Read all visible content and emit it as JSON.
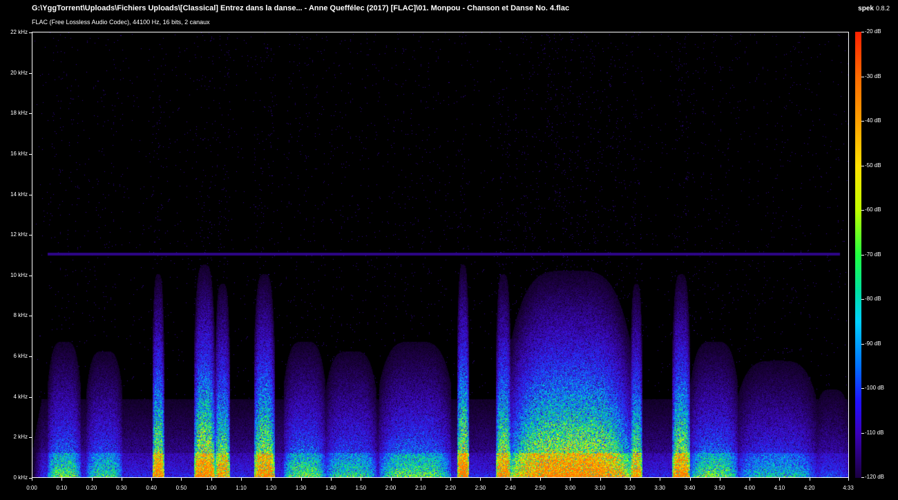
{
  "window": {
    "title": "G:\\YggTorrent\\Uploads\\Fichiers Uploads\\[Classical] Entrez dans la danse... - Anne Queffélec (2017) [FLAC]\\01. Monpou - Chanson et Danse No. 4.flac",
    "subtitle": "FLAC (Free Lossless Audio Codec), 44100 Hz, 16 bits, 2 canaux",
    "app_name": "spek",
    "app_version": "0.8.2"
  },
  "freq_axis": {
    "labels": [
      "0 kHz",
      "2 kHz",
      "4 kHz",
      "6 kHz",
      "8 kHz",
      "10 kHz",
      "12 kHz",
      "14 kHz",
      "16 kHz",
      "18 kHz",
      "20 kHz",
      "22 kHz"
    ],
    "max_khz": 22
  },
  "time_axis": {
    "labels": [
      "0:00",
      "0:10",
      "0:20",
      "0:30",
      "0:40",
      "0:50",
      "1:00",
      "1:10",
      "1:20",
      "1:30",
      "1:40",
      "1:50",
      "2:00",
      "2:10",
      "2:20",
      "2:30",
      "2:40",
      "2:50",
      "3:00",
      "3:10",
      "3:20",
      "3:30",
      "3:40",
      "3:50",
      "4:00",
      "4:10",
      "4:20",
      "4:33"
    ],
    "duration_seconds": 273
  },
  "db_scale": {
    "labels": [
      "-20 dB",
      "-30 dB",
      "-40 dB",
      "-50 dB",
      "-60 dB",
      "-70 dB",
      "-80 dB",
      "-90 dB",
      "-100 dB",
      "-110 dB",
      "-120 dB"
    ],
    "max_db": -20,
    "min_db": -120
  }
}
